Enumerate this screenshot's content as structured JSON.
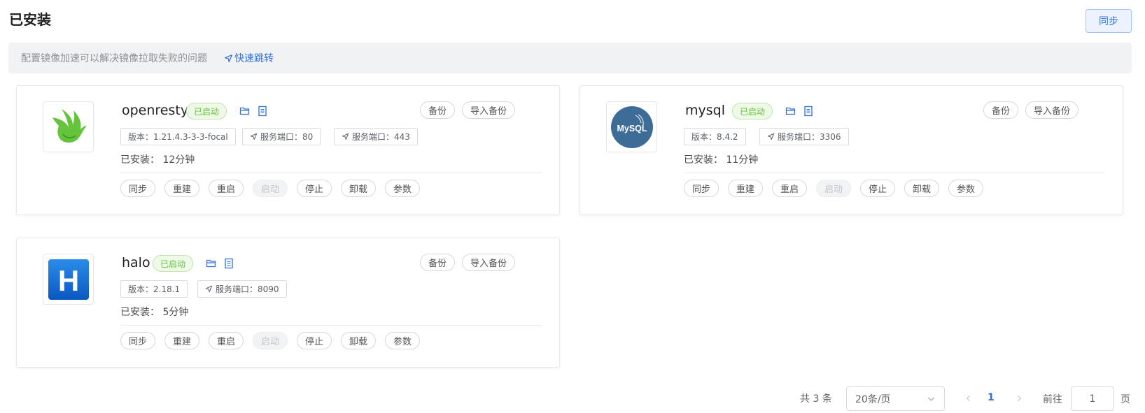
{
  "header": {
    "title": "已安装",
    "sync_label": "同步"
  },
  "notice": {
    "text": "配置镜像加速可以解决镜像拉取失败的问题",
    "link_label": "快速跳转"
  },
  "apps": [
    {
      "name": "openresty",
      "status": "已启动",
      "logo": "openresty-logo",
      "version": "版本：1.21.4.3-3-3-focal",
      "ports": [
        "服务端口：80",
        "服务端口：443"
      ],
      "installed": "已安装： 12分钟",
      "backup_label": "备份",
      "import_label": "导入备份",
      "actions": [
        "同步",
        "重建",
        "重启",
        "启动",
        "停止",
        "卸载",
        "参数"
      ]
    },
    {
      "name": "mysql",
      "status": "已启动",
      "logo": "mysql-logo",
      "logo_text": "MySQL",
      "version": "版本：8.4.2",
      "ports": [
        "服务端口：3306"
      ],
      "installed": "已安装： 11分钟",
      "backup_label": "备份",
      "import_label": "导入备份",
      "actions": [
        "同步",
        "重建",
        "重启",
        "启动",
        "停止",
        "卸载",
        "参数"
      ]
    },
    {
      "name": "halo",
      "status": "已启动",
      "logo": "halo-logo",
      "logo_text": "H",
      "version": "版本：2.18.1",
      "ports": [
        "服务端口：8090"
      ],
      "installed": "已安装： 5分钟",
      "backup_label": "备份",
      "import_label": "导入备份",
      "actions": [
        "同步",
        "重建",
        "重启",
        "启动",
        "停止",
        "卸载",
        "参数"
      ]
    }
  ],
  "pagination": {
    "total": "共 3 条",
    "page_size": "20条/页",
    "current_page": "1",
    "goto_label": "前往",
    "goto_value": "1",
    "page_unit": "页"
  },
  "colors": {
    "accent": "#2f6fe0",
    "status_green": "#67c23a"
  }
}
